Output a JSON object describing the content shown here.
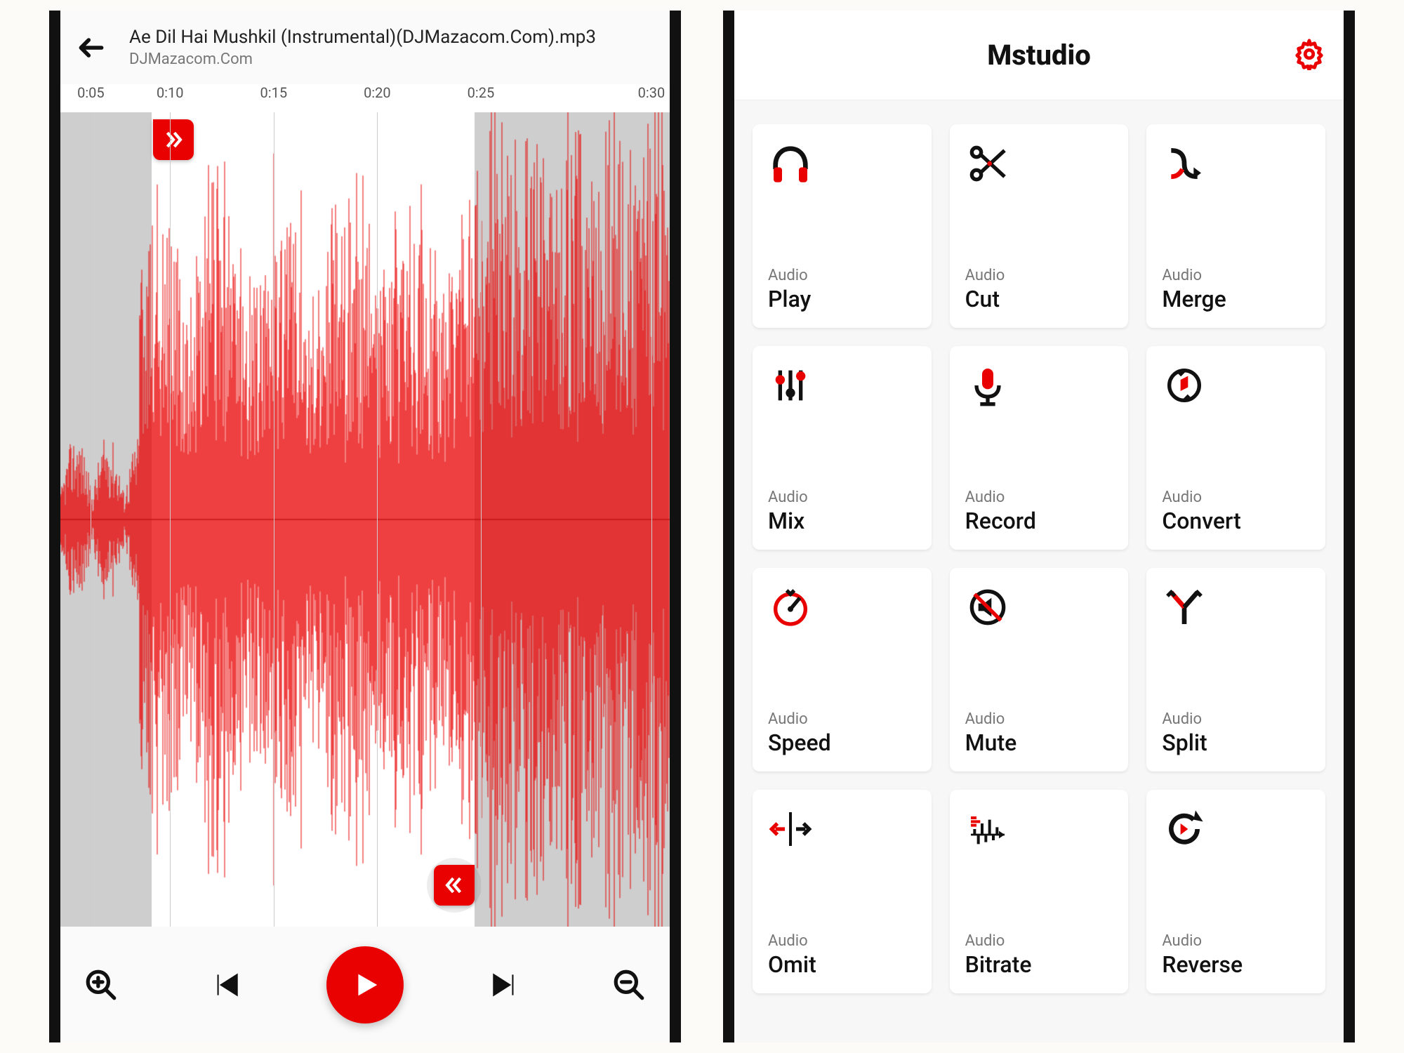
{
  "editor": {
    "title": "Ae Dil Hai Mushkil (Instrumental)(DJMazacom.Com).mp3",
    "subtitle": "DJMazacom.Com",
    "time_ticks": [
      "0:05",
      "0:10",
      "0:15",
      "0:20",
      "0:25",
      "0:30"
    ],
    "tick_positions_pct": [
      5,
      18,
      35,
      52,
      69,
      97
    ],
    "selection_start_pct": 15,
    "selection_end_pct": 68,
    "accent_color": "#e90000"
  },
  "home": {
    "app_title": "Mstudio",
    "tile_overline": "Audio",
    "tiles": [
      {
        "id": "play",
        "label": "Play",
        "icon": "headphones"
      },
      {
        "id": "cut",
        "label": "Cut",
        "icon": "scissors"
      },
      {
        "id": "merge",
        "label": "Merge",
        "icon": "merge"
      },
      {
        "id": "mix",
        "label": "Mix",
        "icon": "sliders"
      },
      {
        "id": "record",
        "label": "Record",
        "icon": "mic"
      },
      {
        "id": "convert",
        "label": "Convert",
        "icon": "convert"
      },
      {
        "id": "speed",
        "label": "Speed",
        "icon": "speed"
      },
      {
        "id": "mute",
        "label": "Mute",
        "icon": "mute"
      },
      {
        "id": "split",
        "label": "Split",
        "icon": "split"
      },
      {
        "id": "omit",
        "label": "Omit",
        "icon": "omit"
      },
      {
        "id": "bitrate",
        "label": "Bitrate",
        "icon": "bitrate"
      },
      {
        "id": "reverse",
        "label": "Reverse",
        "icon": "reverse"
      }
    ]
  }
}
